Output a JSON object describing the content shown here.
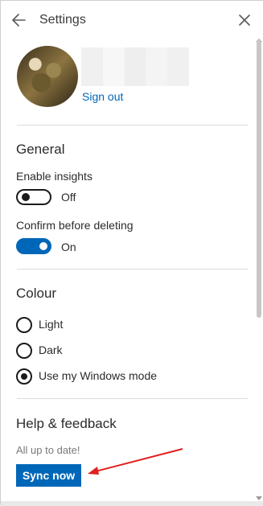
{
  "header": {
    "title": "Settings",
    "back_icon": "back-arrow-icon",
    "close_icon": "close-icon"
  },
  "profile": {
    "sign_out_label": "Sign out"
  },
  "general": {
    "title": "General",
    "insights_label": "Enable insights",
    "insights_state": "Off",
    "insights_on": false,
    "confirm_label": "Confirm before deleting",
    "confirm_state": "On",
    "confirm_on": true
  },
  "colour": {
    "title": "Colour",
    "options": [
      {
        "label": "Light",
        "selected": false
      },
      {
        "label": "Dark",
        "selected": false
      },
      {
        "label": "Use my Windows mode",
        "selected": true
      }
    ]
  },
  "help": {
    "title": "Help & feedback",
    "status": "All up to date!",
    "sync_label": "Sync now"
  },
  "colors": {
    "accent": "#0067b8",
    "annotation": "#e02020"
  }
}
